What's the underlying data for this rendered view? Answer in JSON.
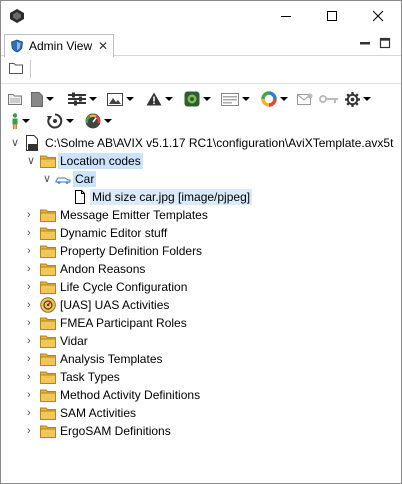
{
  "window": {
    "controls": {
      "minimize": "minimize",
      "maximize": "maximize",
      "close": "close"
    }
  },
  "tab": {
    "label": "Admin View",
    "close_glyph": "✕"
  },
  "tree": {
    "root": {
      "label": "C:\\Solme AB\\AVIX v5.1.17 RC1\\configuration\\AviXTemplate.avx5t"
    },
    "location_codes": {
      "label": "Location codes"
    },
    "car": {
      "label": "Car"
    },
    "car_image": {
      "label": "Mid size car.jpg [image/pjpeg]"
    },
    "items": [
      {
        "label": "Message Emitter Templates",
        "icon": "folder-icon"
      },
      {
        "label": "Dynamic Editor stuff",
        "icon": "folder-icon"
      },
      {
        "label": "Property Definition Folders",
        "icon": "folder-icon"
      },
      {
        "label": "Andon Reasons",
        "icon": "folder-icon"
      },
      {
        "label": "Life Cycle Configuration",
        "icon": "folder-icon"
      },
      {
        "label": "[UAS] UAS Activities",
        "icon": "uas-icon"
      },
      {
        "label": "FMEA Participant Roles",
        "icon": "folder-icon"
      },
      {
        "label": "Vidar",
        "icon": "folder-icon"
      },
      {
        "label": "Analysis Templates",
        "icon": "folder-icon"
      },
      {
        "label": "Task Types",
        "icon": "folder-icon"
      },
      {
        "label": "Method Activity Definitions",
        "icon": "folder-icon"
      },
      {
        "label": "SAM Activities",
        "icon": "folder-icon"
      },
      {
        "label": "ErgoSAM Definitions",
        "icon": "folder-icon"
      }
    ]
  },
  "colors": {
    "selection": "#cce4fb",
    "folder": "#e0b341",
    "folder_edge": "#b8860b"
  }
}
